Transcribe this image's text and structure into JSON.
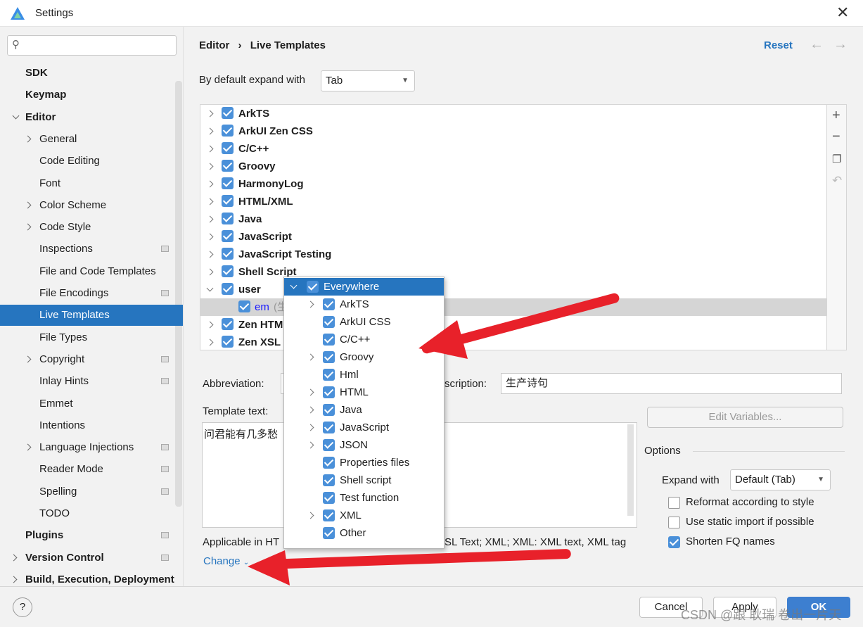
{
  "window": {
    "title": "Settings"
  },
  "sidebar": {
    "search_placeholder": "",
    "items": [
      {
        "label": "SDK",
        "bold": true
      },
      {
        "label": "Keymap",
        "bold": true
      },
      {
        "label": "Editor",
        "bold": true,
        "expanded": true
      },
      {
        "label": "General"
      },
      {
        "label": "Code Editing"
      },
      {
        "label": "Font"
      },
      {
        "label": "Color Scheme"
      },
      {
        "label": "Code Style"
      },
      {
        "label": "Inspections"
      },
      {
        "label": "File and Code Templates"
      },
      {
        "label": "File Encodings"
      },
      {
        "label": "Live Templates",
        "selected": true
      },
      {
        "label": "File Types"
      },
      {
        "label": "Copyright"
      },
      {
        "label": "Inlay Hints"
      },
      {
        "label": "Emmet"
      },
      {
        "label": "Intentions"
      },
      {
        "label": "Language Injections"
      },
      {
        "label": "Reader Mode"
      },
      {
        "label": "Spelling"
      },
      {
        "label": "TODO"
      },
      {
        "label": "Plugins",
        "bold": true
      },
      {
        "label": "Version Control",
        "bold": true
      },
      {
        "label": "Build, Execution, Deployment",
        "bold": true
      }
    ]
  },
  "header": {
    "breadcrumb": [
      "Editor",
      "Live Templates"
    ],
    "separator": "›",
    "reset": "Reset"
  },
  "expand": {
    "label": "By default expand with",
    "value": "Tab"
  },
  "tree": {
    "groups": [
      "ArkTS",
      "ArkUI Zen CSS",
      "C/C++",
      "Groovy",
      "HarmonyLog",
      "HTML/XML",
      "Java",
      "JavaScript",
      "JavaScript Testing",
      "Shell Script",
      "user",
      "Zen HTML",
      "Zen XSL"
    ],
    "child": {
      "abbr": "em",
      "desc": "(生"
    }
  },
  "popup": {
    "items": [
      {
        "label": "Everywhere",
        "level": 0,
        "expanded": true
      },
      {
        "label": "ArkTS",
        "chev": true
      },
      {
        "label": "ArkUI CSS"
      },
      {
        "label": "C/C++"
      },
      {
        "label": "Groovy",
        "chev": true
      },
      {
        "label": "Hml"
      },
      {
        "label": "HTML",
        "chev": true
      },
      {
        "label": "Java",
        "chev": true
      },
      {
        "label": "JavaScript",
        "chev": true
      },
      {
        "label": "JSON",
        "chev": true
      },
      {
        "label": "Properties files"
      },
      {
        "label": "Shell script"
      },
      {
        "label": "Test function"
      },
      {
        "label": "XML",
        "chev": true
      },
      {
        "label": "Other"
      }
    ]
  },
  "form": {
    "abbreviation_label": "Abbreviation:",
    "description_label": "scription:",
    "description_value": "生产诗句",
    "template_label": "Template text:",
    "template_value": "问君能有几多愁",
    "edit_variables": "Edit Variables...",
    "applicable_left": "Applicable in HT",
    "applicable_right": "SL Text; XML; XML: XML text, XML tag",
    "change": "Change"
  },
  "options": {
    "title": "Options",
    "expand_label": "Expand with",
    "expand_value": "Default (Tab)",
    "checks": [
      {
        "label": "Reformat according to style",
        "checked": false
      },
      {
        "label": "Use static import if possible",
        "checked": false
      },
      {
        "label": "Shorten FQ names",
        "checked": true
      }
    ]
  },
  "footer": {
    "help": "?",
    "cancel": "Cancel",
    "apply": "Apply",
    "ok": "OK"
  },
  "watermark": "CSDN @跟 耿瑞 卷出一片天",
  "colors": {
    "accent": "#2675bf",
    "checkbox": "#4a90d9",
    "arrow": "#e8212a"
  }
}
